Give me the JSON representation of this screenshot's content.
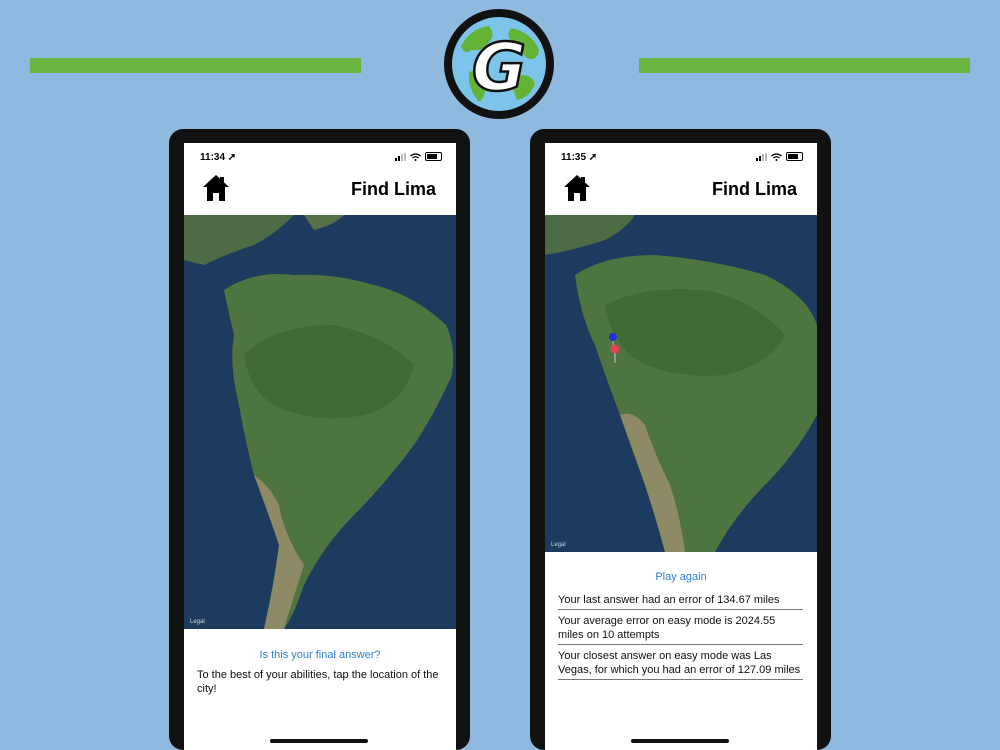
{
  "colors": {
    "background": "#8fb9de",
    "accent_bar": "#6cb540",
    "link": "#2f7fd6"
  },
  "logo": {
    "letter": "G",
    "icon": "globe-logo-icon"
  },
  "phones": [
    {
      "status": {
        "time": "11:34 ➚"
      },
      "nav": {
        "title": "Find Lima",
        "home_icon": "home-icon"
      },
      "map": {
        "legal": "Legal"
      },
      "panel": {
        "link": "Is this your final answer?",
        "hint": "To the best of your abilities, tap the location of the city!"
      }
    },
    {
      "status": {
        "time": "11:35 ➚"
      },
      "nav": {
        "title": "Find Lima",
        "home_icon": "home-icon"
      },
      "map": {
        "legal": "Legal",
        "pins": [
          "blue-pin-icon",
          "red-pin-icon"
        ]
      },
      "panel": {
        "link": "Play again",
        "stats": [
          "Your last answer had an error of 134.67 miles",
          "Your average error on easy mode is 2024.55 miles on 10 attempts",
          "Your closest answer on easy mode was Las Vegas, for which you had an error of 127.09 miles"
        ]
      }
    }
  ]
}
